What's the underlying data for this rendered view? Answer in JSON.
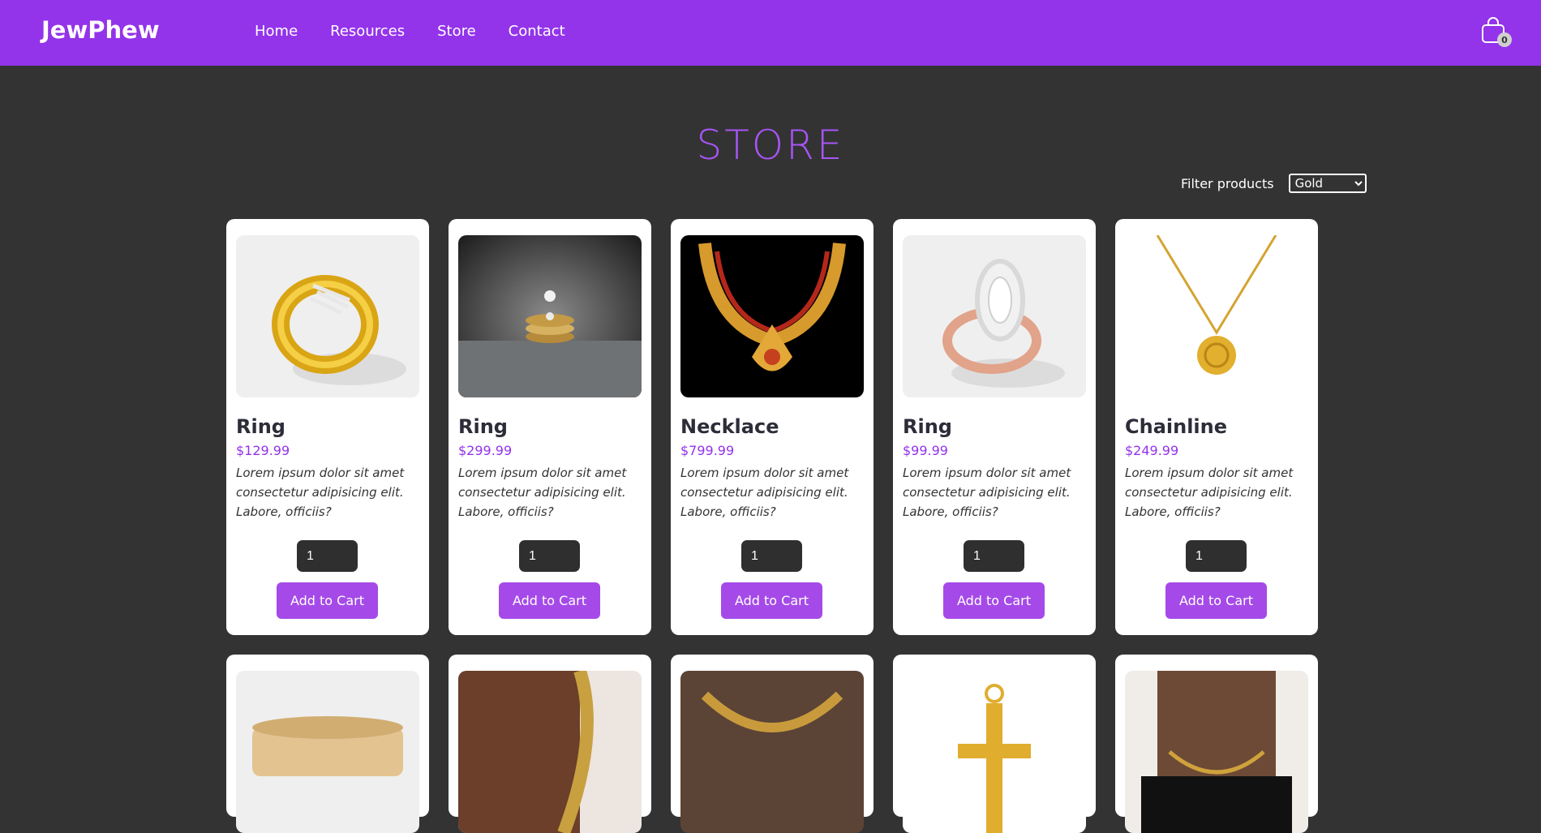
{
  "nav": {
    "brand": "JewPhew",
    "links": [
      "Home",
      "Resources",
      "Store",
      "Contact"
    ],
    "cart_count": "0"
  },
  "store": {
    "title": "STORE",
    "filter_label": "Filter products",
    "filter_selected": "Gold"
  },
  "products": [
    {
      "name": "Ring",
      "price": "$129.99",
      "desc": "Lorem ipsum dolor sit amet consectetur adipisicing elit. Labore, officiis?",
      "qty": "1",
      "button": "Add to Cart"
    },
    {
      "name": "Ring",
      "price": "$299.99",
      "desc": "Lorem ipsum dolor sit amet consectetur adipisicing elit. Labore, officiis?",
      "qty": "1",
      "button": "Add to Cart"
    },
    {
      "name": "Necklace",
      "price": "$799.99",
      "desc": "Lorem ipsum dolor sit amet consectetur adipisicing elit. Labore, officiis?",
      "qty": "1",
      "button": "Add to Cart"
    },
    {
      "name": "Ring",
      "price": "$99.99",
      "desc": "Lorem ipsum dolor sit amet consectetur adipisicing elit. Labore, officiis?",
      "qty": "1",
      "button": "Add to Cart"
    },
    {
      "name": "Chainline",
      "price": "$249.99",
      "desc": "Lorem ipsum dolor sit amet consectetur adipisicing elit. Labore, officiis?",
      "qty": "1",
      "button": "Add to Cart"
    }
  ],
  "colors": {
    "brand": "#9333ea",
    "background": "#333333",
    "price": "#9333ea",
    "button": "#a54ae8"
  }
}
